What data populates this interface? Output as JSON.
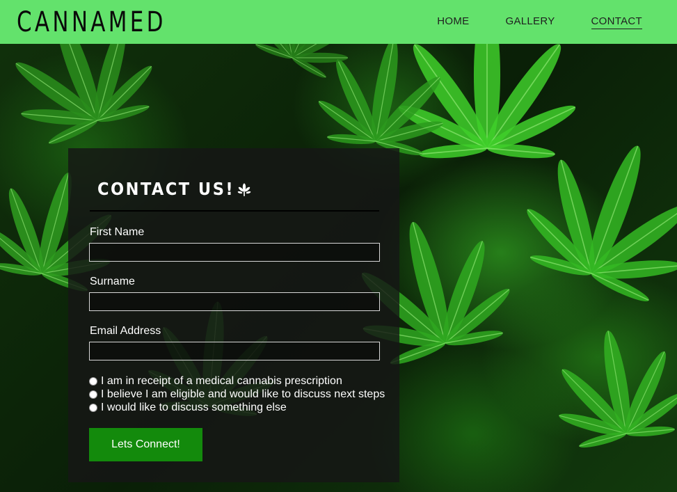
{
  "header": {
    "brand": "CANNAMED",
    "nav": [
      {
        "label": "HOME"
      },
      {
        "label": "GALLERY"
      },
      {
        "label": "CONTACT",
        "active": true
      }
    ]
  },
  "contact": {
    "title": "CONTACT US!",
    "title_icon": "leaf-icon",
    "fields": [
      {
        "label": "First Name",
        "value": "",
        "placeholder": ""
      },
      {
        "label": "Surname",
        "value": "",
        "placeholder": ""
      },
      {
        "label": "Email Address",
        "value": "",
        "placeholder": ""
      }
    ],
    "options": [
      {
        "label": "I am in receipt of a medical cannabis prescription",
        "checked": false
      },
      {
        "label": "I believe I am eligible and would like to discuss next steps",
        "checked": false
      },
      {
        "label": "I would like to discuss something else",
        "checked": false
      }
    ],
    "submit_label": "Lets Connect!"
  },
  "colors": {
    "header_bg": "#63e26c",
    "button_bg": "#138a0c",
    "panel_bg": "#161616"
  }
}
